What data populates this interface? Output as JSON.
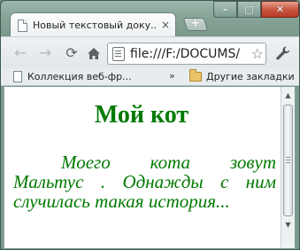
{
  "window": {
    "controls": {
      "minimize": "–",
      "maximize": "□",
      "close": "✕"
    }
  },
  "tab": {
    "title": "Новый текстовый доку...",
    "close": "×",
    "new_tab": "+"
  },
  "toolbar": {
    "icons": [
      "back-icon",
      "forward-icon",
      "reload-icon",
      "home-icon",
      "star-icon",
      "wrench-icon"
    ],
    "address": "file:///F:/DOCUMS/"
  },
  "bookmarks": {
    "collection": "Коллекция веб-фр...",
    "chevron": "»",
    "other": "Другие закладки"
  },
  "page": {
    "heading": "Мой кот",
    "text": "Моего кота зовут Мальтус . Однажды с ним случилась такая история...",
    "text_color": "#007a00"
  }
}
